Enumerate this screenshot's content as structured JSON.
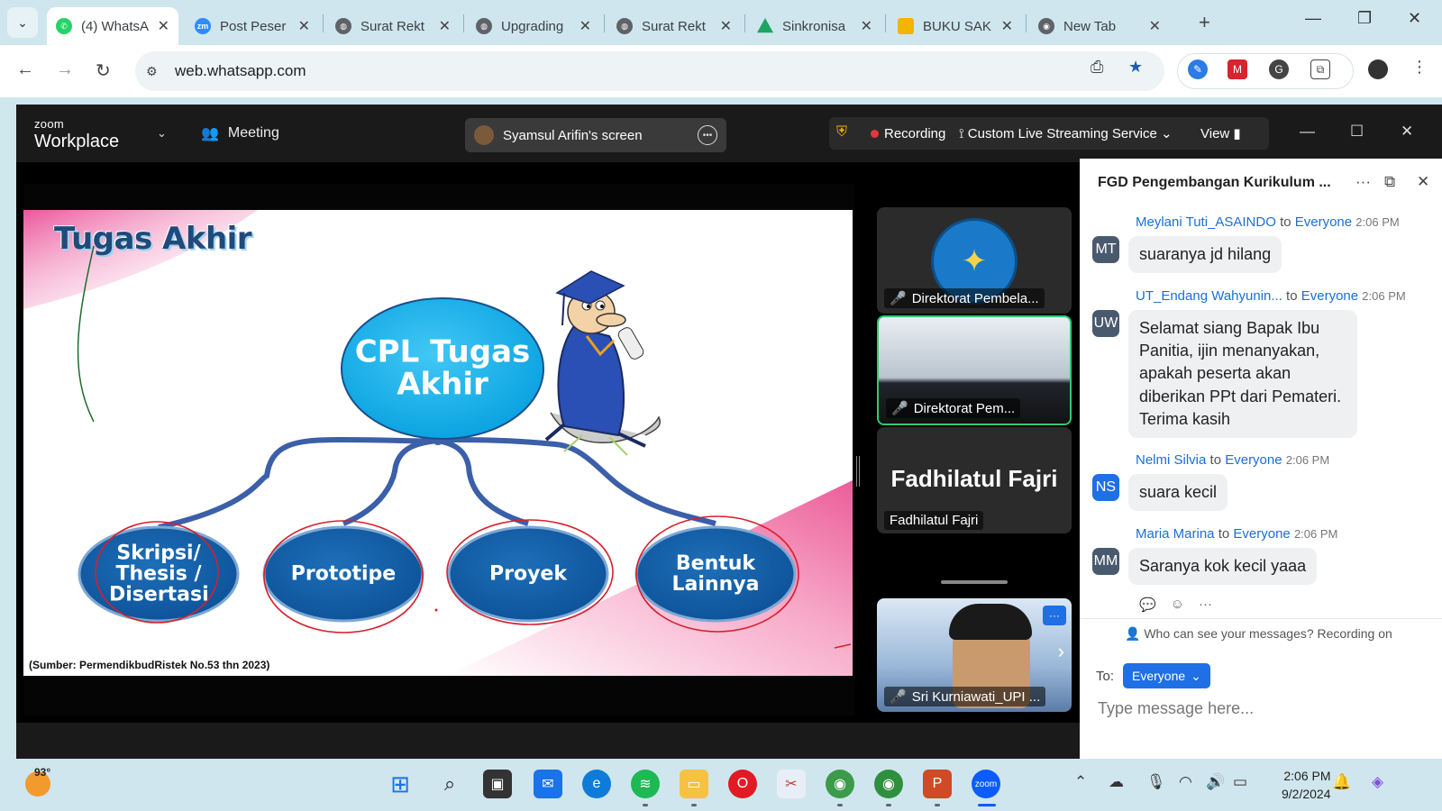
{
  "browser": {
    "tabs": [
      {
        "title": "(4) WhatsA",
        "favicon_color": "#25d366",
        "active": true
      },
      {
        "title": "Post Peser",
        "favicon_color": "#2d8cff"
      },
      {
        "title": "Surat Rekt",
        "favicon_color": "#5f6368"
      },
      {
        "title": "Upgrading",
        "favicon_color": "#5f6368"
      },
      {
        "title": "Surat Rekt",
        "favicon_color": "#5f6368"
      },
      {
        "title": "Sinkronisa",
        "favicon_color": "#1fa463"
      },
      {
        "title": "BUKU SAK",
        "favicon_color": "#f4b400"
      },
      {
        "title": "New Tab",
        "favicon_color": "#5f6368"
      }
    ],
    "url": "web.whatsapp.com"
  },
  "zoom": {
    "brand_small": "zoom",
    "brand_big": "Workplace",
    "meeting_label": "Meeting",
    "screen_label": "Syamsul Arifin's screen",
    "recording_label": "Recording",
    "live_label": "Custom Live Streaming Service",
    "view_label": "View"
  },
  "slide": {
    "title": "Tugas Akhir",
    "center": "CPL Tugas Akhir",
    "nodes": [
      "Skripsi/ Thesis / Disertasi",
      "Prototipe",
      "Proyek",
      "Bentuk Lainnya"
    ],
    "source": "(Sumber: PermendikbudRistek No.53 thn 2023)"
  },
  "participants": [
    {
      "name": "Direktorat Pembela..."
    },
    {
      "name": "Direktorat Pem..."
    },
    {
      "name": "Fadhilatul Fajri",
      "display": "Fadhilatul Fajri"
    },
    {
      "name": "Sri Kurniawati_UPI ..."
    }
  ],
  "chat": {
    "title": "FGD Pengembangan Kurikulum ...",
    "messages": [
      {
        "initials": "MT",
        "sender": "Meylani Tuti_ASAINDO",
        "to": "to",
        "audience": "Everyone",
        "time": "2:06 PM",
        "text": "suaranya jd hilang",
        "color": "#4a5a6e"
      },
      {
        "initials": "UW",
        "sender": "UT_Endang Wahyunin...",
        "to": "to",
        "audience": "Everyone",
        "time": "2:06 PM",
        "text": "Selamat siang Bapak Ibu Panitia, ijin menanyakan, apakah peserta akan diberikan PPt dari Pemateri. Terima kasih",
        "color": "#4a5a6e"
      },
      {
        "initials": "NS",
        "sender": "Nelmi Silvia",
        "to": "to",
        "audience": "Everyone",
        "time": "2:06 PM",
        "text": "suara kecil",
        "color": "#1f6fe5"
      },
      {
        "initials": "MM",
        "sender": "Maria Marina",
        "to": "to",
        "audience": "Everyone",
        "time": "2:06 PM",
        "text": "Saranya kok kecil yaaa",
        "color": "#4a5a6e"
      }
    ],
    "privacy": "Who can see your messages? Recording on",
    "to_label": "To:",
    "recipient": "Everyone",
    "placeholder": "Type message here..."
  },
  "taskbar": {
    "temperature": "93°",
    "time": "2:06 PM",
    "date": "9/2/2024"
  }
}
